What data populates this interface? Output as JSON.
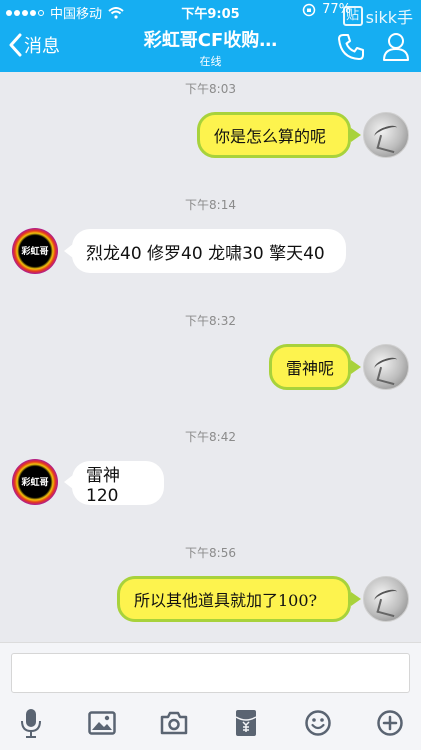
{
  "status_bar": {
    "carrier": "中国移动",
    "time": "下午9:05",
    "battery": "77%",
    "battery_level": 0.77
  },
  "watermark": {
    "icon_char": "贴",
    "text": "sikk手"
  },
  "nav": {
    "back_label": "消息",
    "title": "彩虹哥CF收购…",
    "subtitle": "在线"
  },
  "friend": {
    "avatar_text": "彩虹哥"
  },
  "messages": [
    {
      "time": "下午8:03",
      "sender": "self",
      "text": "你是怎么算的呢"
    },
    {
      "time": "下午8:14",
      "sender": "friend",
      "text": "烈龙40 修罗40 龙啸30 擎天40"
    },
    {
      "time": "下午8:32",
      "sender": "self",
      "text": "雷神呢"
    },
    {
      "time": "下午8:42",
      "sender": "friend",
      "text": "雷神120"
    },
    {
      "time": "下午8:56",
      "sender": "self",
      "text": "所以其他道具就加了100?"
    }
  ],
  "input": {
    "placeholder": ""
  },
  "toolbar_icons": [
    "microphone-icon",
    "image-icon",
    "camera-icon",
    "red-envelope-icon",
    "emoji-icon",
    "plus-icon"
  ],
  "colors": {
    "header": "#16aef2",
    "self_bubble": "#fdf34e",
    "self_bubble_border": "#a8d23b",
    "friend_bubble": "#ffffff",
    "background": "#e9eaee"
  }
}
